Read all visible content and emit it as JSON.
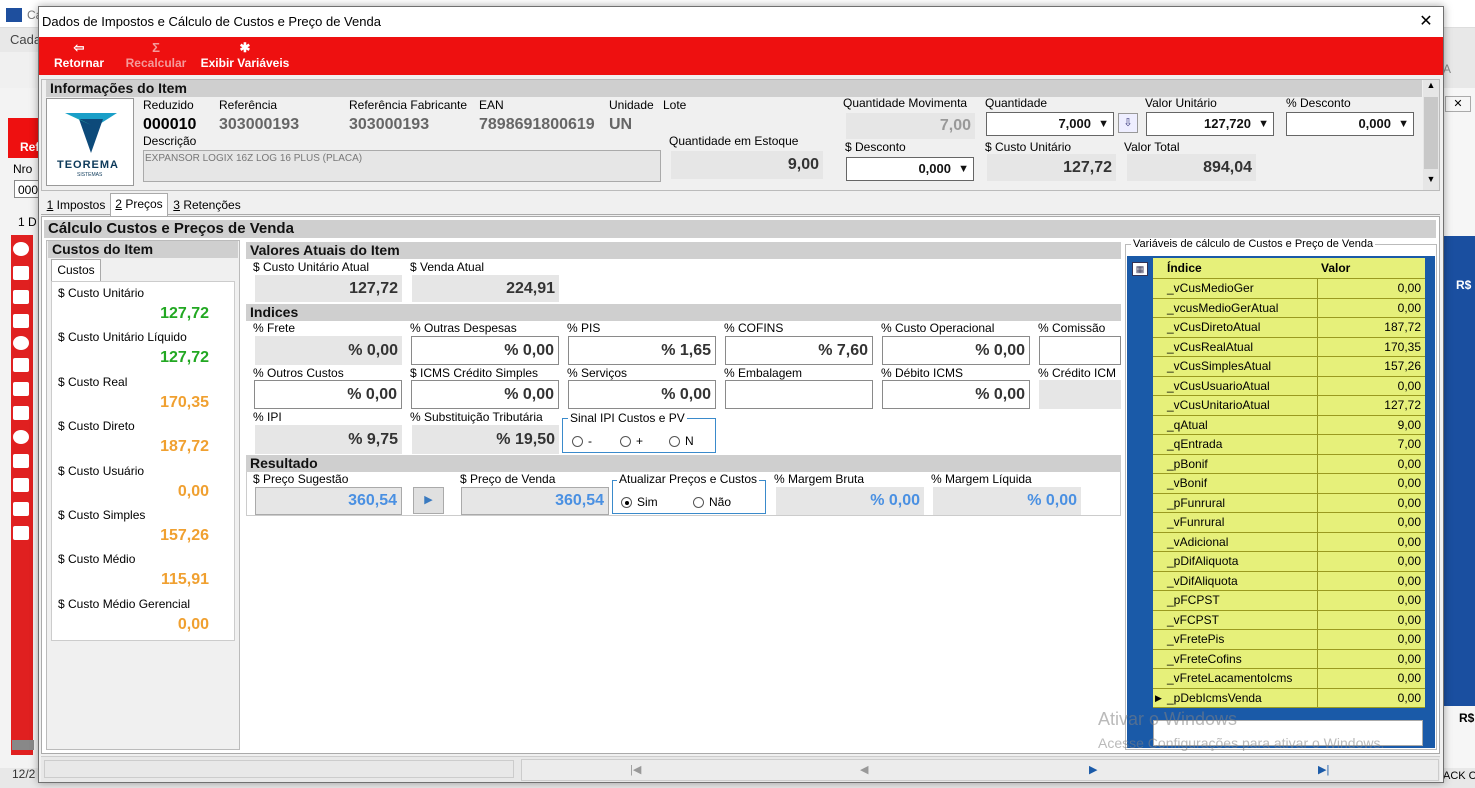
{
  "bg": {
    "app_hint": "Ca",
    "cadastro": "Cada",
    "ref": "Ref",
    "nro": "Nro",
    "nro_val": "000",
    "one_d": "1 D",
    "date": "12/2",
    "rs": "R$",
    "rs2": "R$",
    "ack": "ACK C",
    "edge_a": "A"
  },
  "dialog": {
    "title": "Dados de Impostos e Cálculo de Custos e Preço de Venda",
    "close": "✕"
  },
  "toolbar": {
    "retornar": "Retornar",
    "recalcular": "Recalcular",
    "exibir": "Exibir Variáveis"
  },
  "item": {
    "header": "Informações do Item",
    "logo_text": "TEOREMA",
    "logo_sub": "SISTEMAS",
    "reduzido_label": "Reduzido",
    "reduzido": "000010",
    "referencia_label": "Referência",
    "referencia": "303000193",
    "ref_fab_label": "Referência Fabricante",
    "ref_fab": "303000193",
    "ean_label": "EAN",
    "ean": "7898691800619",
    "unidade_label": "Unidade",
    "unidade": "UN",
    "lote_label": "Lote",
    "descricao_label": "Descrição",
    "descricao": "EXPANSOR LOGIX 16Z LOG 16 PLUS (PLACA)",
    "qtd_estoque_label": "Quantidade em Estoque",
    "qtd_estoque": "9,00",
    "qtd_mov_label": "Quantidade Movimenta",
    "qtd_mov": "7,00",
    "quantidade_label": "Quantidade",
    "quantidade": "7,000",
    "valor_unit_label": "Valor Unitário",
    "valor_unit": "127,720",
    "pct_desc_label": "% Desconto",
    "pct_desc": "0,000",
    "desc_label": "$ Desconto",
    "desc": "0,000",
    "custo_unit_label": "$ Custo Unitário",
    "custo_unit": "127,72",
    "valor_total_label": "Valor Total",
    "valor_total": "894,04"
  },
  "tabs": [
    {
      "key": "1",
      "label": "Impostos"
    },
    {
      "key": "2",
      "label": "Preços"
    },
    {
      "key": "3",
      "label": "Retenções"
    }
  ],
  "calc": {
    "header": "Cálculo Custos e Preços de Venda"
  },
  "custos": {
    "header": "Custos do Item",
    "tab": "Custos",
    "items": [
      {
        "label": "$ Custo Unitário",
        "value": "127,72",
        "color": "#22a822"
      },
      {
        "label": "$ Custo Unitário Líquido",
        "value": "127,72",
        "color": "#22a822"
      },
      {
        "label": "$ Custo Real",
        "value": "170,35",
        "color": "#f0a030"
      },
      {
        "label": "$ Custo Direto",
        "value": "187,72",
        "color": "#f0a030"
      },
      {
        "label": "$ Custo Usuário",
        "value": "0,00",
        "color": "#f0a030"
      },
      {
        "label": "$ Custo Simples",
        "value": "157,26",
        "color": "#f0a030"
      },
      {
        "label": "$ Custo Médio",
        "value": "115,91",
        "color": "#f0a030"
      },
      {
        "label": "$ Custo Médio Gerencial",
        "value": "0,00",
        "color": "#f0a030"
      }
    ]
  },
  "atuais": {
    "header": "Valores Atuais do Item",
    "custo_label": "$ Custo Unitário Atual",
    "custo": "127,72",
    "venda_label": "$ Venda Atual",
    "venda": "224,91"
  },
  "indices": {
    "header": "Indices",
    "frete_label": "% Frete",
    "frete": "% 0,00",
    "outras_label": "% Outras Despesas",
    "outras": "% 0,00",
    "pis_label": "% PIS",
    "pis": "% 1,65",
    "cofins_label": "% COFINS",
    "cofins": "% 7,60",
    "custo_op_label": "% Custo Operacional",
    "custo_op": "% 0,00",
    "comissao_label": "% Comissão",
    "outros_custos_label": "% Outros Custos",
    "outros_custos": "% 0,00",
    "icms_simples_label": "$ ICMS Crédito Simples",
    "icms_simples": "% 0,00",
    "servicos_label": "% Serviços",
    "servicos": "% 0,00",
    "embalagem_label": "% Embalagem",
    "debito_icms_label": "% Débito ICMS",
    "debito_icms": "% 0,00",
    "credito_icms_label": "% Crédito ICM",
    "ipi_label": "% IPI",
    "ipi": "% 9,75",
    "st_label": "% Substituição Tributária",
    "st": "% 19,50",
    "sinal_label": "Sinal IPI Custos e PV",
    "sinal_opts": [
      "-",
      "+",
      "N"
    ]
  },
  "resultado": {
    "header": "Resultado",
    "sugestao_label": "$ Preço Sugestão",
    "sugestao": "360,54",
    "venda_label": "$ Preço de Venda",
    "venda": "360,54",
    "atualizar_label": "Atualizar Preços e Custos",
    "sim": "Sim",
    "nao": "Não",
    "margem_bruta_label": "% Margem Bruta",
    "margem_bruta": "% 0,00",
    "margem_liq_label": "% Margem Líquida",
    "margem_liq": "% 0,00"
  },
  "vars": {
    "header": "Variáveis de cálculo de Custos e Preço de Venda",
    "col_indice": "Índice",
    "col_valor": "Valor",
    "rows": [
      [
        "_vCusMedioGer",
        "0,00"
      ],
      [
        "_vcusMedioGerAtual",
        "0,00"
      ],
      [
        "_vCusDiretoAtual",
        "187,72"
      ],
      [
        "_vCusRealAtual",
        "170,35"
      ],
      [
        "_vCusSimplesAtual",
        "157,26"
      ],
      [
        "_vCusUsuarioAtual",
        "0,00"
      ],
      [
        "_vCusUnitarioAtual",
        "127,72"
      ],
      [
        "_qAtual",
        "9,00"
      ],
      [
        "_qEntrada",
        "7,00"
      ],
      [
        "_pBonif",
        "0,00"
      ],
      [
        "_vBonif",
        "0,00"
      ],
      [
        "_pFunrural",
        "0,00"
      ],
      [
        "_vFunrural",
        "0,00"
      ],
      [
        "_vAdicional",
        "0,00"
      ],
      [
        "_pDifAliquota",
        "0,00"
      ],
      [
        "_vDifAliquota",
        "0,00"
      ],
      [
        "_pFCPST",
        "0,00"
      ],
      [
        "_vFCPST",
        "0,00"
      ],
      [
        "_vFretePis",
        "0,00"
      ],
      [
        "_vFreteCofins",
        "0,00"
      ],
      [
        "_vFreteLacamentoIcms",
        "0,00"
      ],
      [
        "_pDebIcmsVenda",
        "0,00"
      ]
    ]
  },
  "watermark": {
    "line1": "Ativar o Windows",
    "line2": "Acesse Configurações para ativar o Windows."
  },
  "colors": {
    "accent_red": "#ee1010",
    "grid_yellow": "#e6f07a",
    "blue_value": "#4a90e2"
  }
}
